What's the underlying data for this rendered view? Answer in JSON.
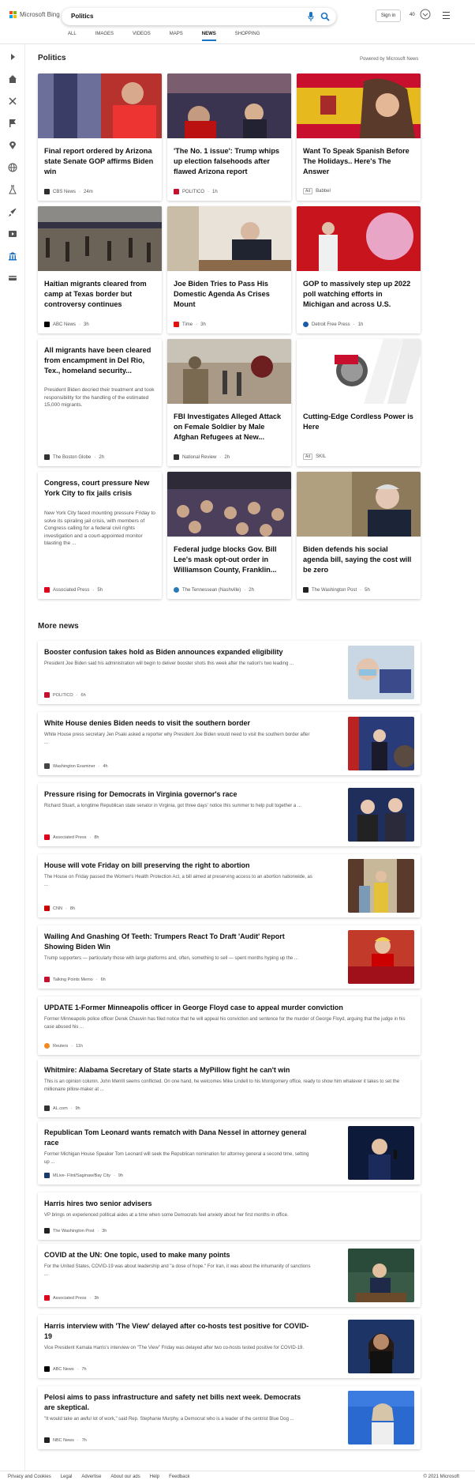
{
  "header": {
    "brand": "Microsoft Bing",
    "search_value": "Politics",
    "signin": "Sign in",
    "points": "40"
  },
  "tabs": [
    "ALL",
    "IMAGES",
    "VIDEOS",
    "MAPS",
    "NEWS",
    "SHOPPING"
  ],
  "section": {
    "title": "Politics",
    "powered": "Powered by Microsoft News"
  },
  "cards": [
    {
      "title": "Final report ordered by Arizona state Senate GOP affirms Biden win",
      "source": "CBS News",
      "time": "24m",
      "color": "#2f2f2f"
    },
    {
      "title": "'The No. 1 issue': Trump whips up election falsehoods after flawed Arizona report",
      "source": "POLITICO",
      "time": "1h",
      "color": "#c8102e"
    },
    {
      "title": "Want To Speak Spanish Before The Holidays.. Here's The Answer",
      "source": "Babbel",
      "time": "",
      "ad": "Ad",
      "color": "#bbb"
    },
    {
      "title": "Haitian migrants cleared from camp at Texas border but controversy continues",
      "source": "ABC News",
      "time": "3h",
      "color": "#000"
    },
    {
      "title": "Joe Biden Tries to Pass His Domestic Agenda As Crises Mount",
      "source": "Time",
      "time": "3h",
      "color": "#e3120b"
    },
    {
      "title": "GOP to massively step up 2022 poll watching efforts in Michigan and across U.S.",
      "source": "Detroit Free Press",
      "time": "1h",
      "color": "#1a5ca8"
    },
    {
      "title": "All migrants have been cleared from encampment in Del Rio, Tex., homeland security...",
      "desc": "President Biden decried their treatment and took responsibility for the handling of the estimated 15,000 migrants.",
      "source": "The Boston Globe",
      "time": "2h",
      "color": "#333"
    },
    {
      "title": "FBI Investigates Alleged Attack on Female Soldier by Male Afghan Refugees at New...",
      "source": "National Review",
      "time": "2h",
      "color": "#333"
    },
    {
      "title": "Cutting-Edge Cordless Power is Here",
      "source": "SKIL",
      "time": "",
      "ad": "Ad",
      "color": "#bbb"
    },
    {
      "title": "Congress, court pressure New York City to fix jails crisis",
      "desc": "New York City faced mounting pressure Friday to solve its spiraling jail crisis, with members of Congress calling for a federal civil rights investigation and a court-appointed monitor blasting the ...",
      "source": "Associated Press",
      "time": "5h",
      "color": "#e0001b"
    },
    {
      "title": "Federal judge blocks Gov. Bill Lee's mask opt-out order in Williamson County, Franklin...",
      "source": "The Tennessean (Nashville)",
      "time": "2h",
      "color": "#2a7ab8"
    },
    {
      "title": "Biden defends his social agenda bill, saying the cost will be zero",
      "source": "The Washington Post",
      "time": "5h",
      "color": "#222"
    }
  ],
  "more_news_title": "More news",
  "more_news": [
    {
      "title": "Booster confusion takes hold as Biden announces expanded eligibility",
      "desc": "President Joe Biden said his administration will begin to deliver booster shots this week after the nation's two leading ...",
      "source": "POLITICO",
      "time": "6h",
      "color": "#c8102e",
      "img": true
    },
    {
      "title": "White House denies Biden needs to visit the southern border",
      "desc": "White House press secretary Jen Psaki asked a reporter why President Joe Biden would need to visit the southern border after ...",
      "source": "Washington Examiner",
      "time": "4h",
      "color": "#444",
      "img": true
    },
    {
      "title": "Pressure rising for Democrats in Virginia governor's race",
      "desc": "Richard Stuart, a longtime Republican state senator in Virginia, got three days' notice this summer to help pull together a ...",
      "source": "Associated Press",
      "time": "8h",
      "color": "#e0001b",
      "img": true
    },
    {
      "title": "House will vote Friday on bill preserving the right to abortion",
      "desc": "The House on Friday passed the Women's Health Protection Act, a bill aimed at preserving access to an abortion nationwide, as ...",
      "source": "CNN",
      "time": "8h",
      "color": "#cc0000",
      "img": true
    },
    {
      "title": "Wailing And Gnashing Of Teeth: Trumpers React To Draft 'Audit' Report Showing Biden Win",
      "desc": "Trump supporters — particularly those with large platforms and, often, something to sell — spent months hyping up the ...",
      "source": "Talking Points Memo",
      "time": "6h",
      "color": "#c8102e",
      "img": true
    },
    {
      "title": "UPDATE 1-Former Minneapolis officer in George Floyd case to appeal murder conviction",
      "desc": "Former Minneapolis police officer Derek Chauvin has filed notice that he will appeal his conviction and sentence for the murder of George Floyd, arguing that the judge in his case abused his ...",
      "source": "Reuters",
      "time": "11h",
      "color": "#f28a1d",
      "img": false
    },
    {
      "title": "Whitmire: Alabama Secretary of State starts a MyPillow fight he can't win",
      "desc": "This is an opinion column. John Merrill seems conflicted. On one hand, he welcomes Mike Lindell to his Montgomery office, ready to show him whatever it takes to set the millionaire pillow-maker at ...",
      "source": "AL.com",
      "time": "9h",
      "color": "#333",
      "img": false
    },
    {
      "title": "Republican Tom Leonard wants rematch with Dana Nessel in attorney general race",
      "desc": "Former Michigan House Speaker Tom Leonard will seek the Republican nomination for attorney general a second time, setting up ...",
      "source": "MLive- Flint/Saginaw/Bay City",
      "time": "9h",
      "color": "#1b3a6b",
      "img": true
    },
    {
      "title": "Harris hires two senior advisers",
      "desc": "VP brings on experienced political aides at a time when some Democrats feel anxiety about her first months in office.",
      "source": "The Washington Post",
      "time": "3h",
      "color": "#222",
      "img": false
    },
    {
      "title": "COVID at the UN: One topic, used to make many points",
      "desc": "For the United States, COVID-19 was about leadership and \"a dose of hope.\" For Iran, it was about the inhumanity of sanctions ...",
      "source": "Associated Press",
      "time": "3h",
      "color": "#e0001b",
      "img": true
    },
    {
      "title": "Harris interview with 'The View' delayed after co-hosts test positive for COVID-19",
      "desc": "Vice President Kamala Harris's interview on \"The View\" Friday was delayed after two co-hosts tested positive for COVID-19.",
      "source": "ABC News",
      "time": "7h",
      "color": "#000",
      "img": true
    },
    {
      "title": "Pelosi aims to pass infrastructure and safety net bills next week. Democrats are skeptical.",
      "desc": "\"It would take an awful lot of work,\" said Rep. Stephanie Murphy, a Democrat who is a leader of the centrist Blue Dog ...",
      "source": "NBC News",
      "time": "7h",
      "color": "#222",
      "img": true
    }
  ],
  "footer": {
    "links": [
      "Privacy and Cookies",
      "Legal",
      "Advertise",
      "About our ads",
      "Help",
      "Feedback"
    ],
    "copyright": "© 2021 Microsoft"
  }
}
